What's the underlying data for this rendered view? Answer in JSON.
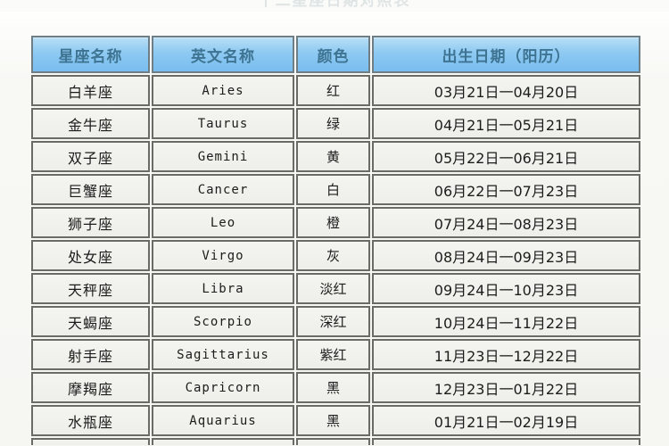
{
  "page": {
    "title_partial": "十二星座日期对照表",
    "background_color": "#f8f8f5"
  },
  "table": {
    "header_bg": "#8dc9f2",
    "header_text_color": "#3e7391",
    "cell_bg": "#f0f0ec",
    "border_color": "#6b6b66",
    "columns": [
      {
        "key": "name",
        "label": "星座名称"
      },
      {
        "key": "en",
        "label": "英文名称"
      },
      {
        "key": "color",
        "label": "颜色"
      },
      {
        "key": "date",
        "label": "出生日期（阳历）"
      }
    ],
    "rows": [
      {
        "name": "白羊座",
        "en": "Aries",
        "color": "红",
        "date": "03月21日一04月20日"
      },
      {
        "name": "金牛座",
        "en": "Taurus",
        "color": "绿",
        "date": "04月21日一05月21日"
      },
      {
        "name": "双子座",
        "en": "Gemini",
        "color": "黄",
        "date": "05月22日一06月21日"
      },
      {
        "name": "巨蟹座",
        "en": "Cancer",
        "color": "白",
        "date": "06月22日一07月23日"
      },
      {
        "name": "狮子座",
        "en": "Leo",
        "color": "橙",
        "date": "07月24日一08月23日"
      },
      {
        "name": "处女座",
        "en": "Virgo",
        "color": "灰",
        "date": "08月24日一09月23日"
      },
      {
        "name": "天秤座",
        "en": "Libra",
        "color": "淡红",
        "date": "09月24日一10月23日"
      },
      {
        "name": "天蝎座",
        "en": "Scorpio",
        "color": "深红",
        "date": "10月24日一11月22日"
      },
      {
        "name": "射手座",
        "en": "Sagittarius",
        "color": "紫红",
        "date": "11月23日一12月22日"
      },
      {
        "name": "摩羯座",
        "en": "Capricorn",
        "color": "黑",
        "date": "12月23日一01月22日"
      },
      {
        "name": "水瓶座",
        "en": "Aquarius",
        "color": "黑",
        "date": "01月21日一02月19日"
      }
    ],
    "clipped_row": {
      "name": "",
      "en": "",
      "color": "",
      "date": ""
    }
  }
}
